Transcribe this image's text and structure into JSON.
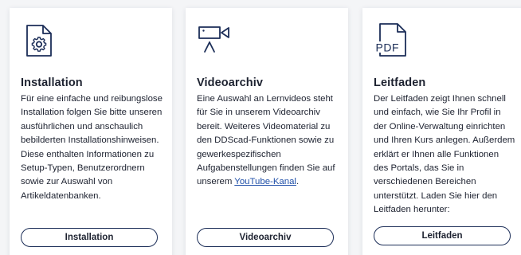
{
  "colors": {
    "icon_stroke": "#1b2d57",
    "link": "#1f4fa8",
    "text": "#1d2230",
    "card_bg": "#ffffff",
    "page_bg": "#f4f5f7"
  },
  "cards": [
    {
      "icon": "document-gear-icon",
      "title": "Installation",
      "text": "Für eine einfache und reibungslose Installation folgen Sie bitte unseren ausführlichen und anschaulich bebilderten Installationshinweisen. Diese enthalten Informationen zu Setup-Typen, Benutzerordnern sowie zur Auswahl von Artikeldatenbanken.",
      "button_label": "Installation"
    },
    {
      "icon": "video-camera-icon",
      "title": "Videoarchiv",
      "text": "Eine Auswahl an Lernvideos steht für Sie in unserem Videoarchiv bereit. Weiteres Videomaterial zu den DDScad-Funktionen sowie zu gewerkespezifischen Aufgabenstellungen finden Sie auf unserem ",
      "link_text": "YouTube-Kanal",
      "text_after_link": ".",
      "button_label": "Videoarchiv"
    },
    {
      "icon": "pdf-document-icon",
      "icon_label": "PDF",
      "title": "Leitfaden",
      "text": "Der Leitfaden zeigt Ihnen schnell und einfach, wie Sie Ihr Profil in der Online-Verwaltung einrichten und Ihren Kurs anlegen. Außerdem erklärt er Ihnen alle Funktionen des Portals, das Sie in verschiedenen Bereichen unterstützt. Laden Sie hier den Leitfaden herunter:",
      "button_label": "Leitfaden"
    }
  ]
}
